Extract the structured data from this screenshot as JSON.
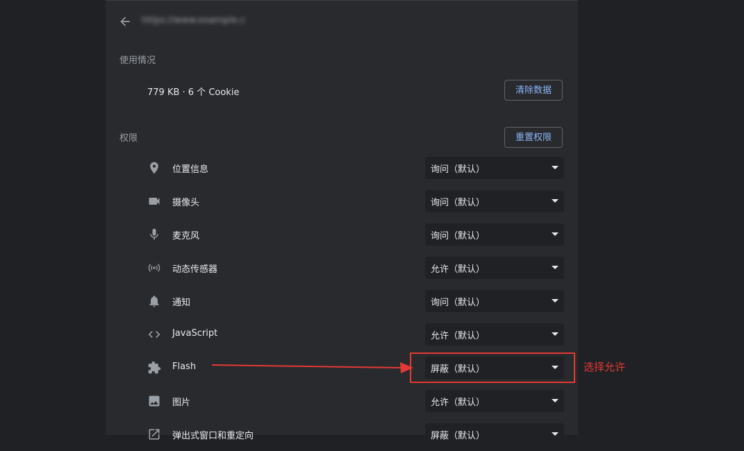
{
  "header": {
    "site_url": "https://www.example.com",
    "back_icon": "arrow-left-icon"
  },
  "usage": {
    "title": "使用情况",
    "summary": "779 KB · 6 个 Cookie",
    "clear_button_label": "清除数据"
  },
  "permissions": {
    "title": "权限",
    "reset_button_label": "重置权限",
    "items": [
      {
        "icon": "location-pin-icon",
        "label": "位置信息",
        "value": "询问（默认）"
      },
      {
        "icon": "video-camera-icon",
        "label": "摄像头",
        "value": "询问（默认）"
      },
      {
        "icon": "microphone-icon",
        "label": "麦克风",
        "value": "询问（默认）"
      },
      {
        "icon": "motion-sensor-icon",
        "label": "动态传感器",
        "value": "允许（默认）"
      },
      {
        "icon": "bell-icon",
        "label": "通知",
        "value": "询问（默认）"
      },
      {
        "icon": "code-brackets-icon",
        "label": "JavaScript",
        "value": "允许（默认）"
      },
      {
        "icon": "puzzle-piece-icon",
        "label": "Flash",
        "value": "屏蔽（默认）"
      },
      {
        "icon": "image-icon",
        "label": "图片",
        "value": "允许（默认）"
      },
      {
        "icon": "popup-redirect-icon",
        "label": "弹出式窗口和重定向",
        "value": "屏蔽（默认）"
      }
    ]
  },
  "annotation": {
    "text": "选择允许",
    "color": "#e53935"
  },
  "colors": {
    "background": "#202124",
    "panel": "#292a2d",
    "accent": "#8ab4f8",
    "text_primary": "#e8eaed",
    "text_secondary": "#9aa0a6"
  }
}
